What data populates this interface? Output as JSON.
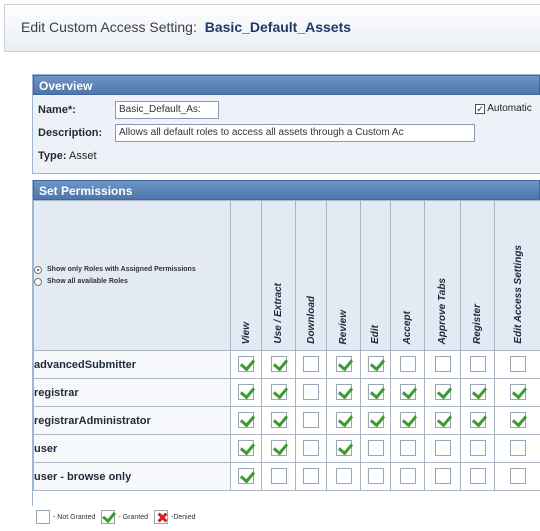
{
  "title": {
    "prefix": "Edit Custom Access Setting:",
    "name": "Basic_Default_Assets"
  },
  "overview": {
    "header": "Overview",
    "name_label": "Name*:",
    "name_value": "Basic_Default_As:",
    "automatic_label": "Automatic",
    "automatic_checked": true,
    "description_label": "Description:",
    "description_value": "Allows all default roles to access all assets through a Custom Ac",
    "type_label": "Type:",
    "type_value": "Asset"
  },
  "permissions": {
    "header": "Set Permissions",
    "radio_options": [
      {
        "label": "Show only Roles with Assigned Permissions",
        "selected": true
      },
      {
        "label": "Show all available Roles",
        "selected": false
      }
    ],
    "columns": [
      "View",
      "Use / Extract",
      "Download",
      "Review",
      "Edit",
      "Accept",
      "Approve Tabs",
      "Register",
      "Edit Access Settings"
    ],
    "rows": [
      {
        "role": "advancedSubmitter",
        "granted": [
          true,
          true,
          false,
          true,
          true,
          false,
          false,
          false,
          false
        ]
      },
      {
        "role": "registrar",
        "granted": [
          true,
          true,
          false,
          true,
          true,
          true,
          true,
          true,
          true
        ]
      },
      {
        "role": "registrarAdministrator",
        "granted": [
          true,
          true,
          false,
          true,
          true,
          true,
          true,
          true,
          true
        ]
      },
      {
        "role": "user",
        "granted": [
          true,
          true,
          false,
          true,
          false,
          false,
          false,
          false,
          false
        ]
      },
      {
        "role": "user - browse only",
        "granted": [
          true,
          false,
          false,
          false,
          false,
          false,
          false,
          false,
          false
        ]
      }
    ]
  },
  "legend": {
    "not_granted": "- Not Granted",
    "granted": "- Granted",
    "denied": "-Denied"
  },
  "colors": {
    "header_blue": "#4d76ab",
    "granted_green": "#3d9a2f",
    "denied_red": "#d02020"
  }
}
